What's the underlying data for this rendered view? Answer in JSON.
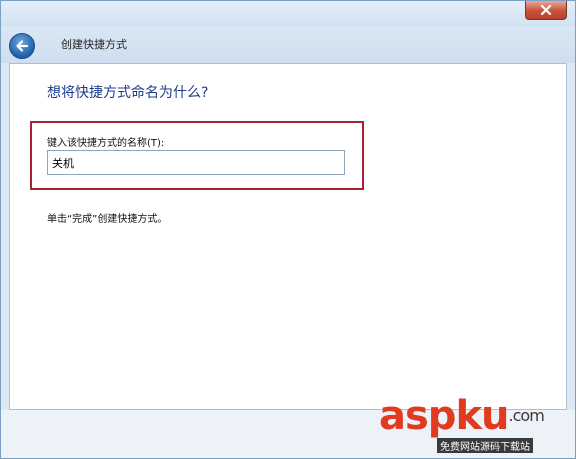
{
  "window": {
    "nav_title": "创建快捷方式"
  },
  "page": {
    "heading": "想将快捷方式命名为什么?",
    "field_label": "键入该快捷方式的名称(T):",
    "field_value": "关机",
    "instruction": "单击“完成”创建快捷方式。"
  },
  "watermark": {
    "brand_asp": "asp",
    "brand_ku": "ku",
    "brand_com": ".com",
    "tagline": "免费网站源码下载站"
  },
  "colors": {
    "accent_heading": "#1e3d8f",
    "highlight_box": "#a8222f",
    "watermark_red": "#e23a1e"
  }
}
